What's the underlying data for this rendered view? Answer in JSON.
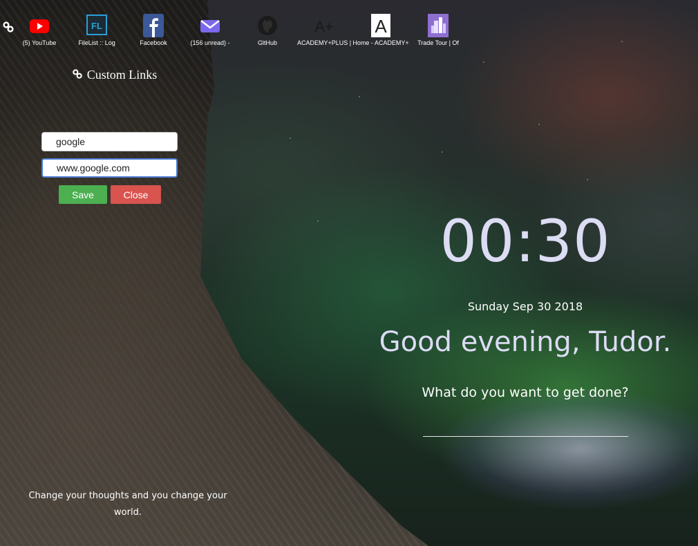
{
  "bookmarks": [
    {
      "label": "(5) YouTube",
      "icon": "youtube-icon"
    },
    {
      "label": "FileList :: Log",
      "icon": "filelist-icon"
    },
    {
      "label": "Facebook",
      "icon": "facebook-icon"
    },
    {
      "label": "(156 unread) -",
      "icon": "mail-icon"
    },
    {
      "label": "GitHub",
      "icon": "github-icon"
    },
    {
      "label": "ACADEMY+PLUS |",
      "icon": "academy-plus-icon"
    },
    {
      "label": "Home - ACADEMY+",
      "icon": "academy-home-icon"
    },
    {
      "label": "Trade Tour | Of",
      "icon": "trade-tour-icon"
    }
  ],
  "icon_text": {
    "filelist": "FL",
    "academy_plus": "A+",
    "academy_home": "A"
  },
  "custom_links": {
    "title": "Custom Links",
    "chain_glyph": "⚭",
    "name_value": "google",
    "url_value": "www.google.com",
    "save_label": "Save",
    "close_label": "Close"
  },
  "quote": "Change your thoughts and you change your world.",
  "clock": {
    "time": "00:30",
    "date": "Sunday Sep 30 2018"
  },
  "greeting": "Good evening, Tudor.",
  "focus": {
    "question": "What do you want to get done?",
    "value": ""
  },
  "colors": {
    "save": "#4caf50",
    "close": "#d9534f",
    "youtube": "#ff0000",
    "facebook": "#3b5998",
    "mail": "#7b68ee",
    "trade_tour": "#8e6fd1",
    "filelist": "#2a9fd6"
  }
}
